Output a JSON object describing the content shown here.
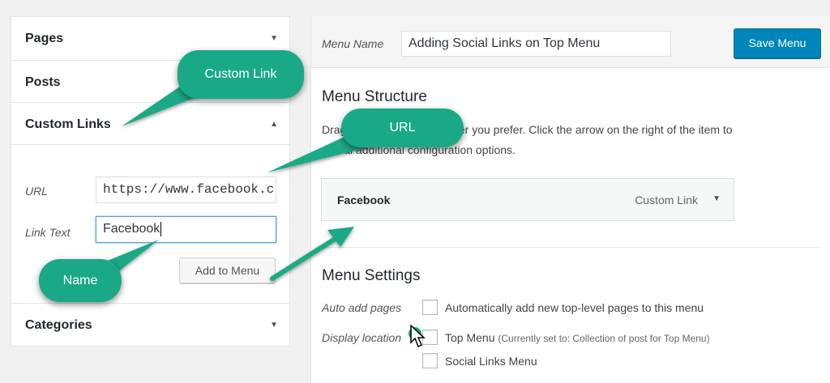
{
  "accordion": {
    "pages": "Pages",
    "posts": "Posts",
    "custom_links": "Custom Links",
    "categories": "Categories"
  },
  "custom_link_form": {
    "url_label": "URL",
    "url_value": "https://www.facebook.c",
    "link_text_label": "Link Text",
    "link_text_value": "Facebook",
    "add_button": "Add to Menu"
  },
  "menu": {
    "name_label": "Menu Name",
    "name_value": "Adding Social Links on Top Menu",
    "save_button": "Save Menu",
    "structure_heading": "Menu Structure",
    "structure_desc_line1": "Drag each item into the order you prefer. Click the arrow on the right of the item to",
    "structure_desc_line2": "reveal additional configuration options.",
    "items": [
      {
        "title": "Facebook",
        "type": "Custom Link"
      }
    ]
  },
  "settings": {
    "heading": "Menu Settings",
    "auto_add_label": "Auto add pages",
    "auto_add_text": "Automatically add new top-level pages to this menu",
    "display_location_label": "Display location",
    "top_menu_text": "Top Menu",
    "top_menu_note": "(Currently set to: Collection of post for Top Menu)",
    "social_links_text": "Social Links Menu"
  },
  "callouts": {
    "custom_link": "Custom Link",
    "url": "URL",
    "name": "Name"
  },
  "icons": {
    "collapse": "triangle-down-icon",
    "expand": "triangle-up-icon",
    "cursor": "mouse-pointer-icon"
  },
  "colors": {
    "primary": "#0085ba",
    "callout": "#1aa986"
  }
}
